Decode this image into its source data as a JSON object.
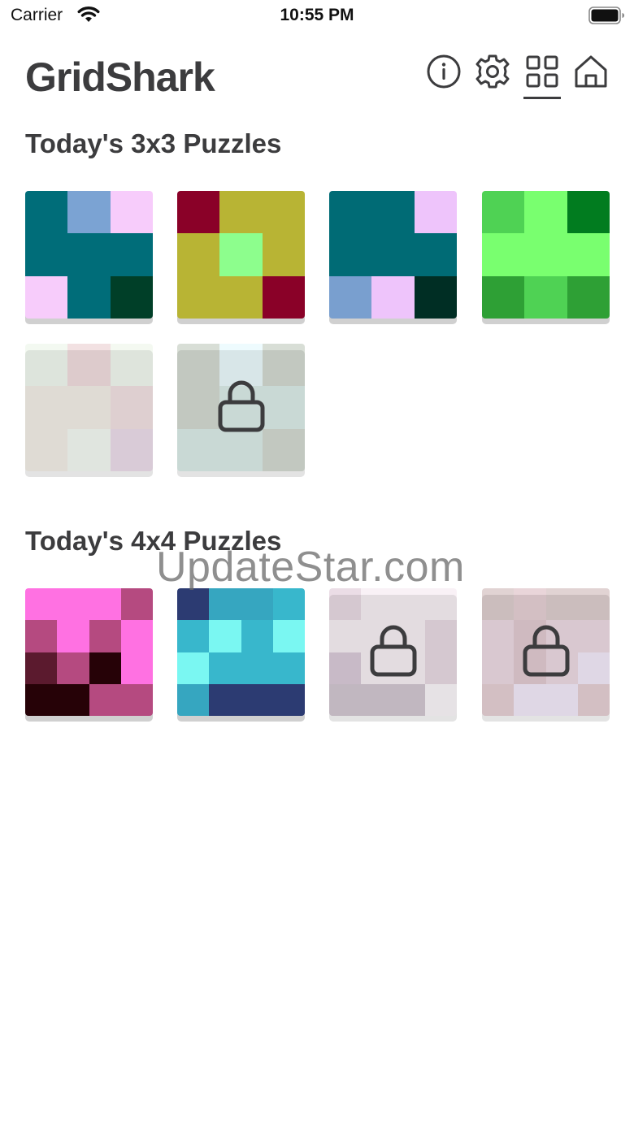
{
  "status_bar": {
    "carrier": "Carrier",
    "time": "10:55 PM"
  },
  "header": {
    "title": "GridShark",
    "icons": [
      "info-icon",
      "gear-icon",
      "grid-icon",
      "home-icon"
    ],
    "active_icon": "grid-icon"
  },
  "sections": [
    {
      "title": "Today's 3x3 Puzzles",
      "size": 3,
      "puzzles": [
        {
          "locked": false,
          "faded": false,
          "colors": [
            "#006d79",
            "#7ba3d3",
            "#f7ccfb",
            "#006d79",
            "#006d79",
            "#006d79",
            "#f7ccfb",
            "#006d79",
            "#003f28"
          ]
        },
        {
          "locked": false,
          "faded": false,
          "colors": [
            "#8a0128",
            "#b8b434",
            "#b8b434",
            "#b8b434",
            "#8dfe8d",
            "#b8b434",
            "#b8b434",
            "#b8b434",
            "#8a0128"
          ]
        },
        {
          "locked": false,
          "faded": false,
          "colors": [
            "#006b75",
            "#006b75",
            "#eec4fb",
            "#006b75",
            "#006b75",
            "#006b75",
            "#799fcf",
            "#eec4fb",
            "#002e24"
          ]
        },
        {
          "locked": false,
          "faded": false,
          "colors": [
            "#4fd254",
            "#79ff6f",
            "#017c1f",
            "#79ff6f",
            "#79ff6f",
            "#79ff6f",
            "#2ea035",
            "#4fd254",
            "#2ea035"
          ]
        },
        {
          "locked": false,
          "faded": true,
          "colors": [
            "#cce8c4",
            "#c97a80",
            "#d1e8c4",
            "#d4c2a0",
            "#d4c2a0",
            "#cf8d90",
            "#d4c2a0",
            "#d6ecd2",
            "#b77aae"
          ]
        },
        {
          "locked": true,
          "faded": true,
          "colors": [
            "#536e47",
            "#b3f1fb",
            "#536e47",
            "#536e47",
            "#70b8a5",
            "#70b8a5",
            "#70b8a5",
            "#70b8a5",
            "#536e47"
          ]
        }
      ]
    },
    {
      "title": "Today's 4x4 Puzzles",
      "size": 4,
      "puzzles": [
        {
          "locked": false,
          "faded": false,
          "colors": [
            "#ff71e2",
            "#ff71e2",
            "#ff71e2",
            "#b54a80",
            "#b54a80",
            "#ff71e2",
            "#b54a80",
            "#ff71e2",
            "#5b1a2e",
            "#b54a80",
            "#260207",
            "#ff71e2",
            "#260207",
            "#260207",
            "#b54a80",
            "#b54a80"
          ]
        },
        {
          "locked": false,
          "faded": false,
          "colors": [
            "#2c3b72",
            "#36a6c0",
            "#36a6c0",
            "#38b7cc",
            "#38b7cc",
            "#7af7f2",
            "#38b7cc",
            "#7af7f2",
            "#7af7f2",
            "#38b7cc",
            "#38b7cc",
            "#38b7cc",
            "#36a6c0",
            "#2c3b72",
            "#2c3b72",
            "#2c3b72"
          ]
        },
        {
          "locked": true,
          "faded": true,
          "colors": [
            "#a86a92",
            "#e6c4d8",
            "#e6c4d8",
            "#e6c4d8",
            "#e6c4d8",
            "#e6c4d8",
            "#e6c4d8",
            "#a86a92",
            "#6b2c66",
            "#e6c4d8",
            "#e6c4d8",
            "#a86a92",
            "#4e1f47",
            "#4e1f47",
            "#4e1f47",
            "#f3dfee"
          ]
        },
        {
          "locked": true,
          "faded": true,
          "colors": [
            "#7a3a3a",
            "#9f4457",
            "#7a3a3a",
            "#7a3a3a",
            "#b96d90",
            "#8b2b4a",
            "#b96d90",
            "#b96d90",
            "#b96d90",
            "#8b2b4a",
            "#b96d90",
            "#d4b0ef",
            "#9f4457",
            "#d4b0ef",
            "#d4b0ef",
            "#9f4457"
          ]
        }
      ]
    }
  ],
  "watermark": "UpdateStar.com"
}
